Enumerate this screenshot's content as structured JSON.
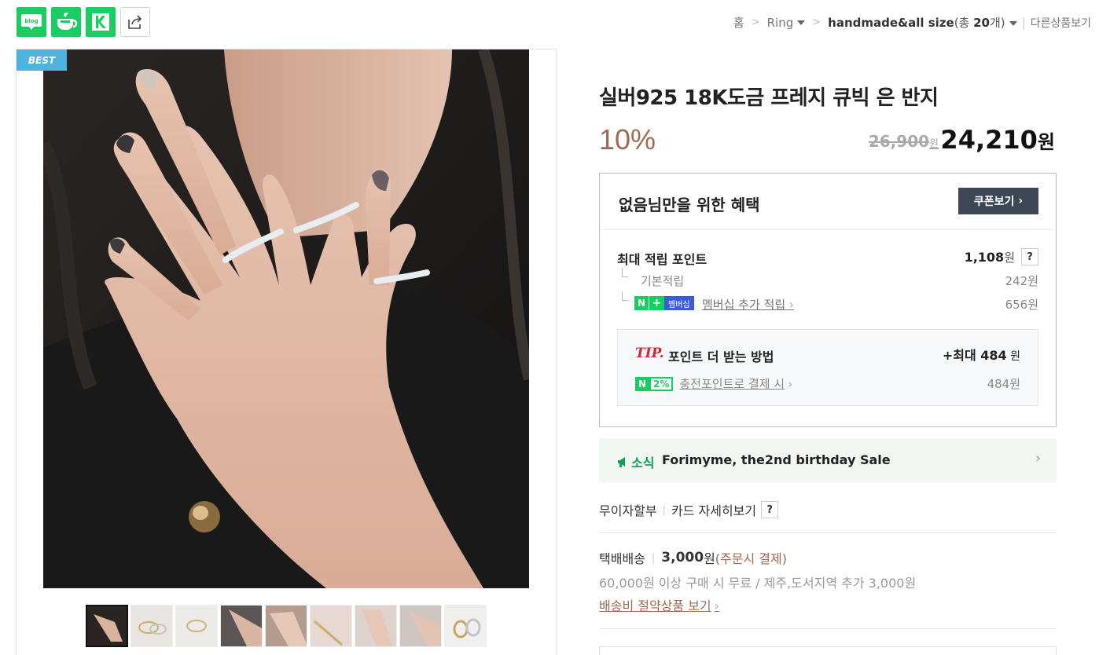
{
  "share": {
    "blog_label": "blog",
    "icons": [
      "naver-blog-icon",
      "naver-cafe-icon",
      "k-icon",
      "share-icon"
    ]
  },
  "breadcrumb": {
    "home": "홈",
    "category": "Ring",
    "subcategory": "handmade&all size",
    "count_prefix": "(총 ",
    "count_value": "20",
    "count_suffix": "개)",
    "other_products": "다른상품보기"
  },
  "image": {
    "badge": "BEST",
    "thumbnail_count": 9
  },
  "product": {
    "title": "실버925 18K도금 프레지 큐빅 은 반지",
    "discount": "10%",
    "original_price": "26,900",
    "original_unit": "원",
    "price": "24,210",
    "price_unit": "원"
  },
  "benefit": {
    "title": "없음님만을 위한 혜택",
    "coupon_button": "쿠폰보기",
    "max_points_label": "최대 적립 포인트",
    "max_points_value": "1,108",
    "max_points_unit": "원",
    "question": "?",
    "basic_label": "기본적립",
    "basic_value": "242원",
    "membership_n": "N",
    "membership_plus": "+",
    "membership_badge": "멤버십",
    "membership_label": "멤버십 추가 적립",
    "membership_value": "656원",
    "tip_word": "TIP.",
    "tip_text": "포인트 더 받는 방법",
    "tip_max_prefix": "+최대 ",
    "tip_max_value": "484",
    "tip_max_unit": " 원",
    "npay_n": "N",
    "npay_pct": "2%",
    "charge_label": "충전포인트로 결제 시",
    "charge_value": "484원"
  },
  "news": {
    "label": "소식",
    "text": "Forimyme, the2nd birthday Sale"
  },
  "payment": {
    "installment": "무이자할부",
    "card_detail": "카드 자세히보기",
    "question": "?"
  },
  "shipping": {
    "method": "택배배송",
    "fee": "3,000",
    "fee_unit": "원",
    "condition": "(주문시 결제)",
    "free_condition": "60,000원 이상 구매 시 무료 / 제주,도서지역 추가 3,000원",
    "saving_link": "배송비 절약상품 보기"
  },
  "colors": {
    "naver_green": "#19ce60",
    "discount_brown": "#a06a50",
    "best_blue": "#4fb3e0",
    "coupon_dark": "#3c4655",
    "tip_red": "#d9232d"
  }
}
